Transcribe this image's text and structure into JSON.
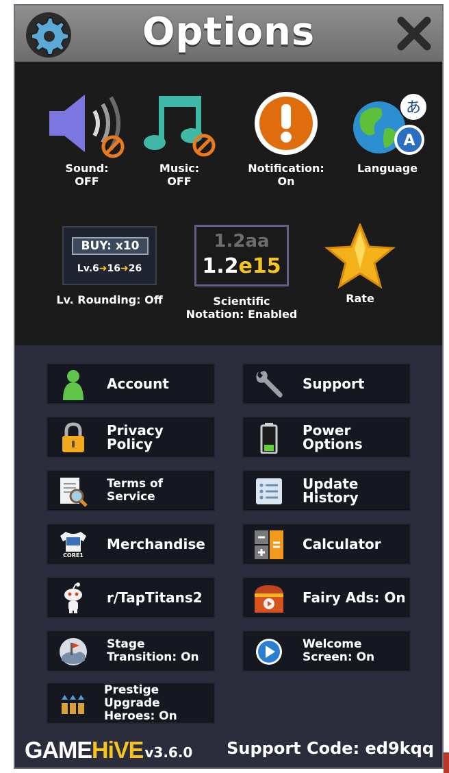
{
  "header": {
    "title": "Options"
  },
  "toggles": [
    {
      "line1": "Sound:",
      "line2": "OFF"
    },
    {
      "line1": "Music:",
      "line2": "OFF"
    },
    {
      "line1": "Notification:",
      "line2": "On"
    },
    {
      "line1": "Language",
      "line2": ""
    }
  ],
  "lv_rounding": {
    "badge": "BUY: x10",
    "lv_a": "Lv.6",
    "lv_b": "16",
    "lv_c": "26",
    "label": "Lv. Rounding: Off"
  },
  "scientific": {
    "old": "1.2aa",
    "new_base": "1.2",
    "new_exp": "e15",
    "line1": "Scientific",
    "line2": "Notation: Enabled"
  },
  "rate": {
    "label": "Rate"
  },
  "language_glyphs": {
    "ja": "あ",
    "en": "A"
  },
  "buttons": {
    "account": "Account",
    "support": "Support",
    "privacy": "Privacy Policy",
    "power": "Power Options",
    "terms_1": "Terms of",
    "terms_2": "Service",
    "update": "Update History",
    "merch": "Merchandise",
    "merch_shirt": "CORE1",
    "calculator": "Calculator",
    "reddit": "r/TapTitans2",
    "fairy": "Fairy Ads: On",
    "stage_1": "Stage",
    "stage_2": "Transition:  On",
    "welcome_1": "Welcome",
    "welcome_2": "Screen: On",
    "prestige_1": "Prestige Upgrade",
    "prestige_2": "Heroes: On"
  },
  "footer": {
    "logo_game": "GAME",
    "logo_hive": "HiVE",
    "version": "v3.6.0",
    "support_code": "Support Code: ed9kqq"
  },
  "colors": {
    "panel": "#2b2c3c",
    "header": "#7d7d7d",
    "top_bg": "#1c1b1b",
    "button": "#151821",
    "accent_yellow": "#f6c421",
    "teal": "#3fb8a8"
  }
}
